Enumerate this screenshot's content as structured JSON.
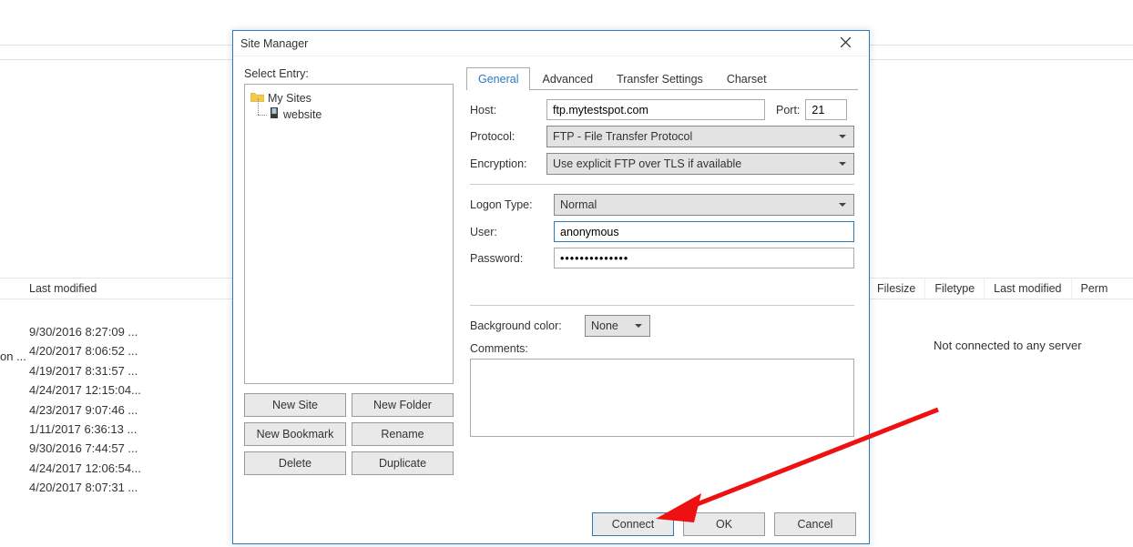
{
  "bg": {
    "left_col": "Last modified",
    "right_cols": [
      "Filesize",
      "Filetype",
      "Last modified",
      "Perm"
    ],
    "truncated_row": "on ...",
    "dates": [
      "9/30/2016 8:27:09 ...",
      "4/20/2017 8:06:52 ...",
      "4/19/2017 8:31:57 ...",
      "4/24/2017 12:15:04...",
      "4/23/2017 9:07:46 ...",
      "1/11/2017 6:36:13 ...",
      "9/30/2016 7:44:57 ...",
      "4/24/2017 12:06:54...",
      "4/20/2017 8:07:31 ..."
    ],
    "not_connected": "Not connected to any server"
  },
  "dialog": {
    "title": "Site Manager",
    "select_entry_label": "Select Entry:",
    "tree": {
      "root": "My Sites",
      "child": "website"
    },
    "buttons": {
      "new_site": "New Site",
      "new_folder": "New Folder",
      "new_bookmark": "New Bookmark",
      "rename": "Rename",
      "delete": "Delete",
      "duplicate": "Duplicate"
    },
    "tabs": {
      "general": "General",
      "advanced": "Advanced",
      "transfer": "Transfer Settings",
      "charset": "Charset"
    },
    "form": {
      "host_label": "Host:",
      "host_value": "ftp.mytestspot.com",
      "port_label": "Port:",
      "port_value": "21",
      "protocol_label": "Protocol:",
      "protocol_value": "FTP - File Transfer Protocol",
      "encryption_label": "Encryption:",
      "encryption_value": "Use explicit FTP over TLS if available",
      "logon_label": "Logon Type:",
      "logon_value": "Normal",
      "user_label": "User:",
      "user_value": "anonymous",
      "password_label": "Password:",
      "password_value": "••••••••••••••",
      "bgcolor_label": "Background color:",
      "bgcolor_value": "None",
      "comments_label": "Comments:",
      "comments_value": ""
    },
    "footer": {
      "connect": "Connect",
      "ok": "OK",
      "cancel": "Cancel"
    }
  }
}
